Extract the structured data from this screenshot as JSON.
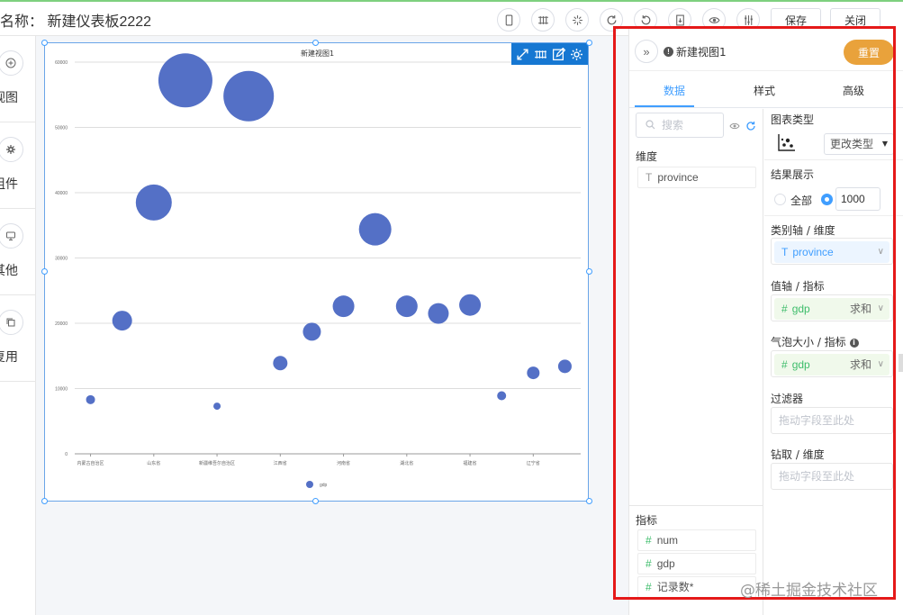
{
  "header": {
    "title": "名称： 新建仪表板2222",
    "save_label": "保存",
    "close_label": "关闭",
    "icons": [
      "mobile-icon",
      "grid-icon",
      "sparkle-icon",
      "refresh-icon",
      "undo-icon",
      "export-icon",
      "eye-icon",
      "equalizer-icon"
    ]
  },
  "sidebar": {
    "items": [
      {
        "label": "视图",
        "icon": "plus-circle-icon"
      },
      {
        "label": "组件",
        "icon": "component-icon"
      },
      {
        "label": "其他",
        "icon": "monitor-icon"
      },
      {
        "label": "复用",
        "icon": "copy-icon"
      }
    ]
  },
  "panel": {
    "view_name": "新建视图1",
    "reset_label": "重置",
    "tabs": [
      {
        "label": "数据",
        "active": true
      },
      {
        "label": "样式",
        "active": false
      },
      {
        "label": "高级",
        "active": false
      }
    ],
    "search_placeholder": "搜索",
    "dimension_title": "维度",
    "dimensions": [
      {
        "label": "province",
        "symbol": "T"
      }
    ],
    "metric_title": "指标",
    "metrics": [
      {
        "label": "num",
        "symbol": "#"
      },
      {
        "label": "gdp",
        "symbol": "#"
      },
      {
        "label": "记录数*",
        "symbol": "#"
      }
    ],
    "chart_type_label": "图表类型",
    "change_type_label": "更改类型",
    "result_label": "结果展示",
    "result_all_label": "全部",
    "result_count": "1000",
    "category_axis_label": "类别轴 / 维度",
    "category_field": {
      "symbol": "T",
      "label": "province"
    },
    "value_axis_label": "值轴 / 指标",
    "value_field": {
      "symbol": "#",
      "label": "gdp",
      "agg": "求和"
    },
    "bubble_label": "气泡大小 / 指标",
    "bubble_field": {
      "symbol": "#",
      "label": "gdp",
      "agg": "求和"
    },
    "filter_label": "过滤器",
    "filter_placeholder": "拖动字段至此处",
    "drill_label": "钻取 / 维度",
    "drill_placeholder": "拖动字段至此处"
  },
  "watermark": "@稀土掘金技术社区",
  "colors": {
    "accent": "#409eff",
    "bubble": "#5470c6",
    "reset": "#e9a23b",
    "highlight": "#e51919"
  },
  "chart_data": {
    "type": "scatter",
    "title": "新建视图1",
    "xlabel": "",
    "ylabel": "",
    "ylim": [
      0,
      60000
    ],
    "yticks": [
      0,
      10000,
      20000,
      30000,
      40000,
      50000,
      60000
    ],
    "x_tick_labels": [
      "内蒙古自治区",
      "山东省",
      "新疆维吾尔自治区",
      "江西省",
      "河南省",
      "湖北省",
      "福建省",
      "辽宁省"
    ],
    "grid": true,
    "legend": [
      "gdp"
    ],
    "legend_position": "bottom-center",
    "series": [
      {
        "name": "gdp",
        "points": [
          {
            "x": 0,
            "y": 8300,
            "r": 5
          },
          {
            "x": 1,
            "y": 20400,
            "r": 11
          },
          {
            "x": 2,
            "y": 38500,
            "r": 20
          },
          {
            "x": 3,
            "y": 57200,
            "r": 30
          },
          {
            "x": 4,
            "y": 7300,
            "r": 4
          },
          {
            "x": 5,
            "y": 54800,
            "r": 28
          },
          {
            "x": 6,
            "y": 13900,
            "r": 8
          },
          {
            "x": 7,
            "y": 18700,
            "r": 10
          },
          {
            "x": 8,
            "y": 22600,
            "r": 12
          },
          {
            "x": 9,
            "y": 34400,
            "r": 18
          },
          {
            "x": 10,
            "y": 22600,
            "r": 12
          },
          {
            "x": 11,
            "y": 21500,
            "r": 11.5
          },
          {
            "x": 12,
            "y": 22800,
            "r": 12
          },
          {
            "x": 13,
            "y": 8900,
            "r": 5
          },
          {
            "x": 14,
            "y": 12400,
            "r": 7
          },
          {
            "x": 15,
            "y": 13400,
            "r": 7.5
          }
        ]
      }
    ]
  }
}
